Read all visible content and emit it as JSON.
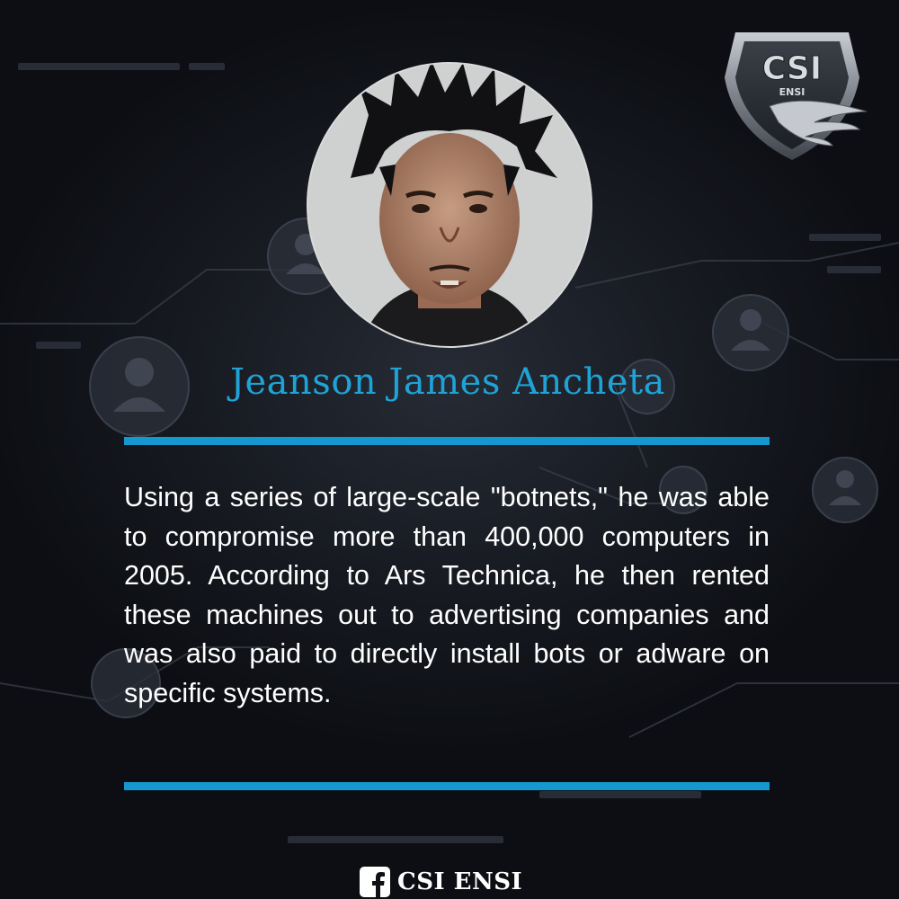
{
  "person": {
    "name": "Jeanson James Ancheta",
    "description": "Using a series of large-scale \"botnets,\" he was able to compromise more than 400,000 computers in 2005. According to Ars Technica, he then rented these machines out to advertising companies and was also paid to directly install bots or adware on specific systems."
  },
  "logo": {
    "text": "CSI",
    "subtext": "ENSI"
  },
  "footer": {
    "label": "CSI ENSI",
    "icon": "facebook-icon"
  },
  "colors": {
    "accent": "#1fa3d6",
    "rule": "#1598cf",
    "background": "#0e1016",
    "text": "#ffffff"
  }
}
